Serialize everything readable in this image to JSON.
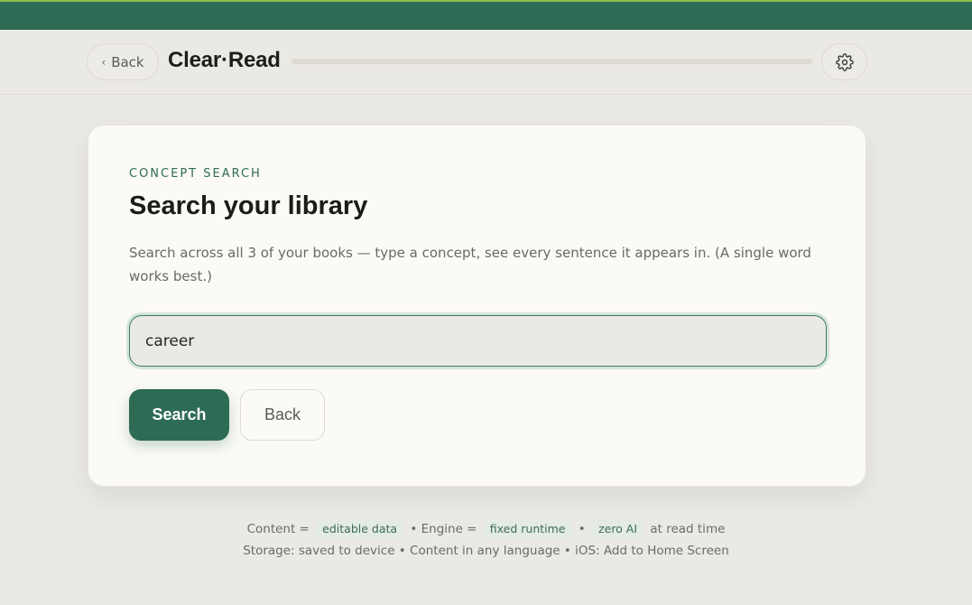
{
  "header": {
    "back_label": "Back",
    "back_chevron": "‹",
    "brand": "Clear·Read",
    "settings_icon": "gear-icon"
  },
  "card": {
    "eyebrow": "CONCEPT SEARCH",
    "title": "Search your library",
    "description": "Search across all 3 of your books — type a concept, see every sentence it appears in. (A single word works best.)",
    "search_value": "career",
    "search_button": "Search",
    "back_button": "Back"
  },
  "footer": {
    "line1": {
      "content_label": "Content =",
      "content_chip": "editable data",
      "engine_label": "• Engine =",
      "engine_chip": "fixed runtime",
      "bullet": "•",
      "ai_chip": "zero AI",
      "tail": "at read time"
    },
    "line2": "Storage: saved to device • Content in any language • iOS: Add to Home Screen"
  },
  "colors": {
    "accent": "#2e6b55",
    "topbar_stripe": "#8fc04a",
    "background": "#ebe9e3",
    "card": "#fbfaf6"
  }
}
